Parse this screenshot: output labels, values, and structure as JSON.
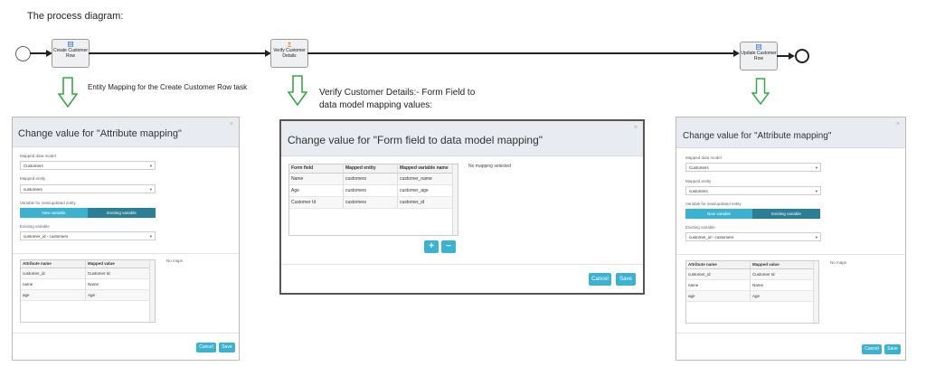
{
  "diagram": {
    "title": "The process diagram:",
    "tasks": [
      {
        "label": "Create Customer Row",
        "icon": "table-icon"
      },
      {
        "label": "Verify Customer Details",
        "icon": "user-icon"
      },
      {
        "label": "Update Customer Row",
        "icon": "table-icon"
      }
    ],
    "captions": {
      "left": "Entity Mapping for the Create Customer Row task",
      "middle_line1": "Verify Customer Details:- Form Field to",
      "middle_line2": "data model mapping values:"
    }
  },
  "left_dialog": {
    "title": "Change value for \"Attribute mapping\"",
    "close": "×",
    "mapped_data_model_label": "Mapped data model",
    "mapped_data_model_value": "Customers",
    "mapped_entity_label": "Mapped entity",
    "mapped_entity_value": "customers",
    "variable_label": "Variable for new/updated entity",
    "new_variable": "New variable",
    "existing_variable": "Existing variable",
    "existing_label": "Existing variable",
    "existing_value": "customer_id - customers",
    "columns": [
      "Attribute name",
      "Mapped value"
    ],
    "rows": [
      [
        "customer_id",
        "Customer Id"
      ],
      [
        "name",
        "Name"
      ],
      [
        "age",
        "Age"
      ]
    ],
    "side_note": "No maps",
    "cancel": "Cancel",
    "save": "Save"
  },
  "middle_dialog": {
    "title": "Change value for \"Form field to data model mapping\"",
    "close": "×",
    "columns": [
      "Form field",
      "Mapped entity",
      "Mapped variable name"
    ],
    "rows": [
      [
        "Name",
        "customers",
        "customer_name"
      ],
      [
        "Age",
        "customers",
        "customer_age"
      ],
      [
        "Customer Id",
        "customers",
        "customer_id"
      ]
    ],
    "no_mapping": "No mapping selected",
    "add": "+",
    "remove": "−",
    "cancel": "Cancel",
    "save": "Save"
  },
  "right_dialog": {
    "title": "Change value for \"Attribute mapping\"",
    "close": "×",
    "mapped_data_model_label": "Mapped data model",
    "mapped_data_model_value": "Customers",
    "mapped_entity_label": "Mapped entity",
    "mapped_entity_value": "customers",
    "variable_label": "Variable for new/updated entity",
    "new_variable": "New variable",
    "existing_variable": "Existing variable",
    "existing_label": "Existing variable",
    "existing_value": "customer_id - customers",
    "columns": [
      "Attribute name",
      "Mapped value"
    ],
    "rows": [
      [
        "customer_id",
        "Customer Id"
      ],
      [
        "name",
        "Name"
      ],
      [
        "age",
        "Age"
      ]
    ],
    "side_note": "No maps",
    "cancel": "Cancel",
    "save": "Save"
  },
  "colors": {
    "accent": "#3db1d0",
    "toggle_dark": "#2a7f97",
    "arrow_green": "#3aa64a",
    "header_bg": "#e8ecf0"
  }
}
